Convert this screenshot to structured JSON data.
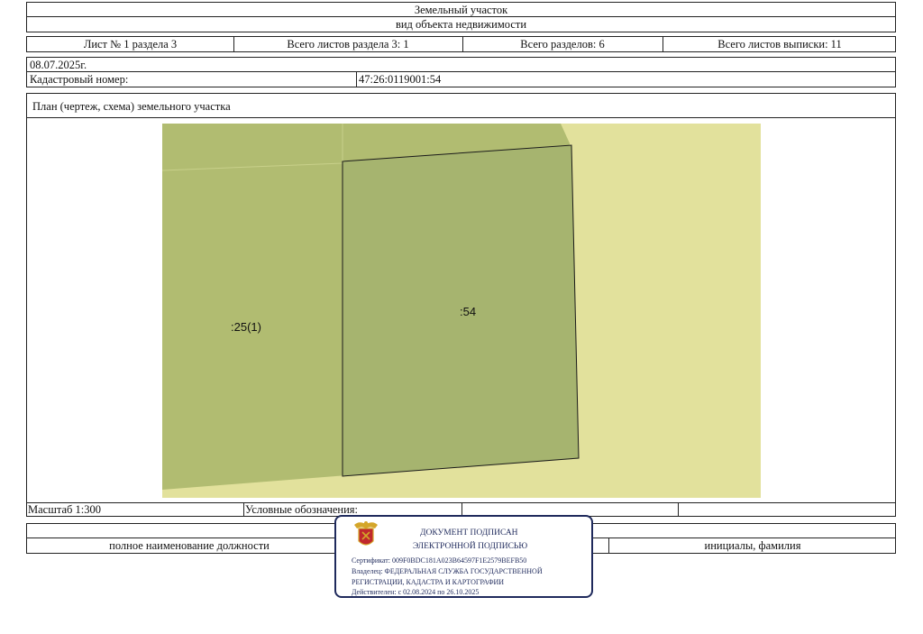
{
  "header": {
    "watermark": "· · · · · · · · ·",
    "title": "Земельный участок",
    "subtitle": "вид объекта недвижимости"
  },
  "sheet_info": {
    "sheet": "Лист № 1 раздела 3",
    "total_sheets_section": "Всего листов раздела 3: 1",
    "total_sections": "Всего разделов: 6",
    "total_sheets_extract": "Всего листов выписки: 11"
  },
  "date": "08.07.2025г.",
  "cadastral": {
    "label": "Кадастровый номер:",
    "value": "47:26:0119001:54"
  },
  "plan": {
    "title": "План (чертеж, схема) земельного участка",
    "colors": {
      "background_parcel": "#e2e19c",
      "neighbor_parcel": "#b1bc71",
      "target_parcel": "#a6b46f",
      "outline": "#1a1a1a"
    },
    "labels": {
      "neighbor": ":25(1)",
      "target": ":54"
    }
  },
  "scale": {
    "label": "Масштаб 1:300",
    "legend_label": "Условные обозначения:"
  },
  "signature": {
    "position_label": "полное наименование должности",
    "name_label": "инициалы, фамилия"
  },
  "stamp": {
    "line1": "ДОКУМЕНТ ПОДПИСАН",
    "line2": "ЭЛЕКТРОННОЙ ПОДПИСЬЮ",
    "certificate": "Сертификат: 009F0BDC181A023B64597F1E2579BEFB50",
    "owner1": "Владелец: ФЕДЕРАЛЬНАЯ СЛУЖБА ГОСУДАРСТВЕННОЙ",
    "owner2": "РЕГИСТРАЦИИ, КАДАСТРА И КАРТОГРАФИИ",
    "valid": "Действителен: с 02.08.2024 по 26.10.2025",
    "colors": {
      "border": "#1f2a5c",
      "emblem_red": "#c0282d",
      "emblem_gold": "#d4a62a"
    }
  }
}
